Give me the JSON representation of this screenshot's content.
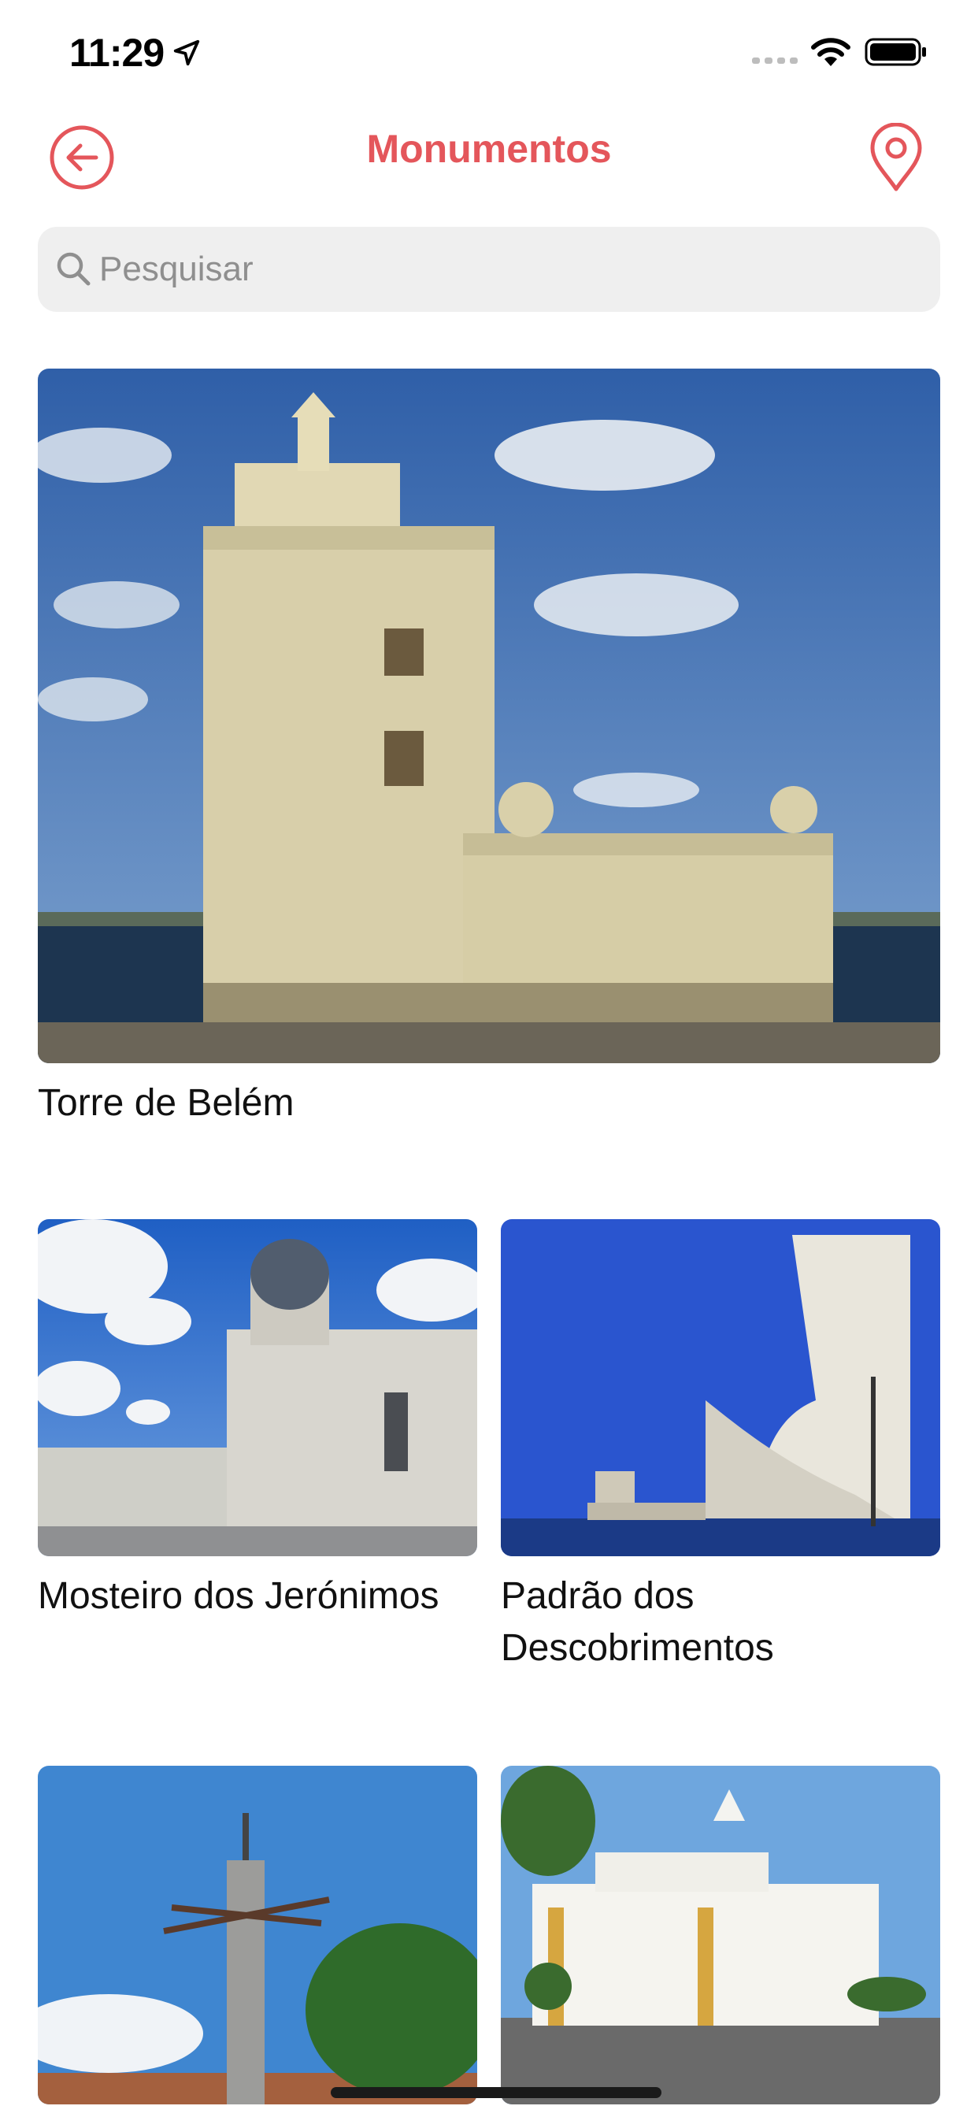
{
  "status_bar": {
    "time": "11:29"
  },
  "nav": {
    "title": "Monumentos",
    "accent_color": "#e4565b",
    "back_icon": "back-arrow-circle-icon",
    "map_icon": "location-pin-icon"
  },
  "search": {
    "placeholder": "Pesquisar",
    "value": ""
  },
  "monuments": [
    {
      "title": "Torre de Belém"
    },
    {
      "title": "Mosteiro dos Jerónimos"
    },
    {
      "title_line1": "Padrão dos",
      "title_line2": "Descobrimentos"
    },
    {
      "title": ""
    },
    {
      "title": ""
    }
  ]
}
